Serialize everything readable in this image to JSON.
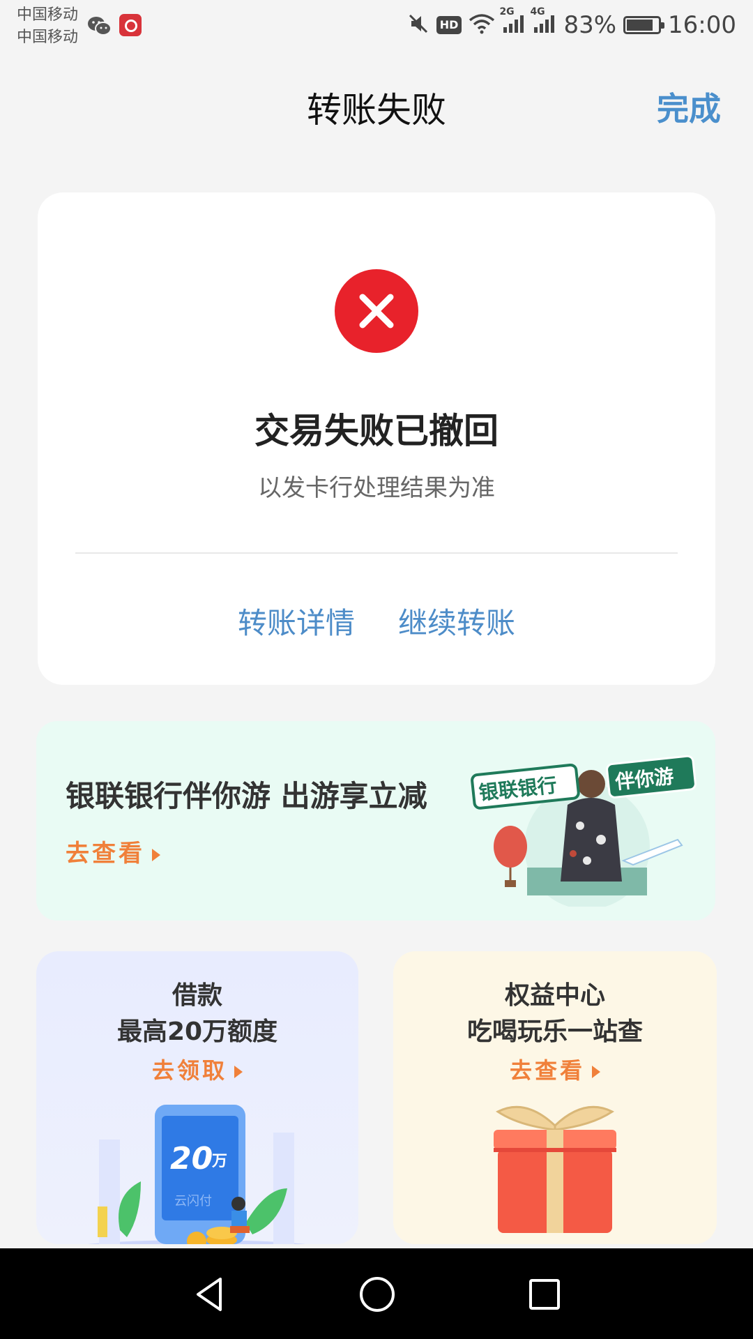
{
  "status_bar": {
    "carrier_1": "中国移动",
    "carrier_2": "中国移动",
    "hd_badge": "HD",
    "net_2g": "2G",
    "net_4g": "4G",
    "battery": "83%",
    "battery_level": 0.83,
    "time": "16:00",
    "icons": [
      "wechat-icon",
      "bank-app-icon",
      "mute-icon",
      "wifi-icon",
      "signal-icon",
      "battery-icon"
    ]
  },
  "header": {
    "title": "转账失败",
    "done_label": "完成"
  },
  "result": {
    "icon": "close-icon",
    "icon_color": "#e8222b",
    "title": "交易失败已撤回",
    "subtitle": "以发卡行处理结果为准",
    "actions": [
      {
        "label": "转账详情"
      },
      {
        "label": "继续转账"
      }
    ]
  },
  "promo": {
    "title": "银联银行伴你游 出游享立减",
    "cta": "去查看",
    "art_badge_left": "银联银行",
    "art_badge_right": "伴你游"
  },
  "tiles": [
    {
      "title": "借款",
      "subtitle": "最高20万额度",
      "cta": "去领取",
      "art_amount": "20",
      "art_unit": "万",
      "art_caption": "云闪付"
    },
    {
      "title": "权益中心",
      "subtitle": "吃喝玩乐一站查",
      "cta": "去查看",
      "art": "gift-box-icon"
    }
  ],
  "nav_bar": {
    "buttons": [
      "back-nav-icon",
      "home-nav-icon",
      "recents-nav-icon"
    ]
  },
  "colors": {
    "accent_blue": "#4d8cc8",
    "cta_orange": "#f0803a",
    "error_red": "#e8222b",
    "promo_bg": "#e9fbf4",
    "loan_bg": "#e8ecfe",
    "benefit_bg": "#fdf7e6"
  }
}
